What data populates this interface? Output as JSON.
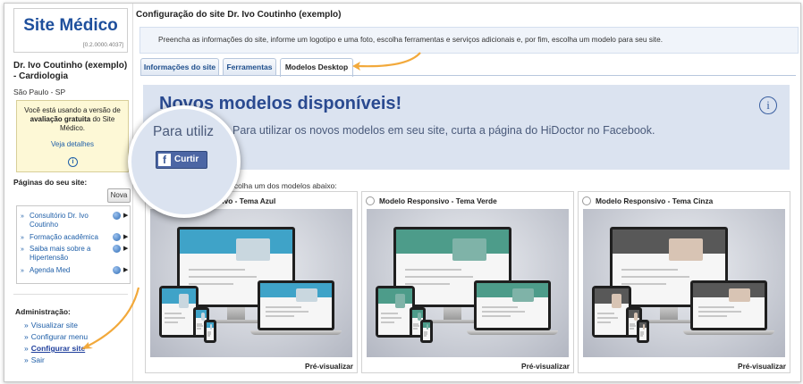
{
  "sidebar": {
    "logo_title": "Site Médico",
    "version": "[0.2.0000.4037]",
    "doctor_name": "Dr. Ivo Coutinho (exemplo) - Cardiologia",
    "city": "São Paulo - SP",
    "evaluation": {
      "text_before": "Você está usando a versão de ",
      "text_bold": "avaliação gratuita",
      "text_after": " do Site Médico.",
      "link": "Veja detalhes",
      "icon": "info-icon"
    },
    "pages_label": "Páginas do seu site:",
    "new_button": "Nova",
    "pages": [
      {
        "label": "Consultório Dr. Ivo Coutinho"
      },
      {
        "label": "Formação acadêmica"
      },
      {
        "label": "Saiba mais sobre a Hipertensão"
      },
      {
        "label": "Agenda Med"
      }
    ],
    "admin_label": "Administração:",
    "admin_items": [
      {
        "label": "Visualizar site"
      },
      {
        "label": "Configurar menu"
      },
      {
        "label": "Configurar site"
      },
      {
        "label": "Sair"
      }
    ]
  },
  "main": {
    "title": "Configuração do site Dr. Ivo Coutinho (exemplo)",
    "intro": "Preencha as informações do site, informe um logotipo e uma foto, escolha ferramentas e serviços adicionais e, por fim, escolha um modelo para seu site.",
    "tabs": [
      {
        "label": "Informações do site"
      },
      {
        "label": "Ferramentas"
      },
      {
        "label": "Modelos Desktop"
      }
    ],
    "active_tab": "Modelos Desktop",
    "banner": {
      "title": "Novos modelos disponíveis!",
      "subtitle": "Para utilizar os novos modelos em seu site, curta a página do HiDoctor no Facebook.",
      "icon": "info-icon"
    },
    "magnifier": {
      "text": "Para utiliz",
      "facebook_button": "Curtir",
      "facebook_icon": "f"
    },
    "choose_text": "Escolha um dos modelos abaixo:",
    "models": [
      {
        "title": "Modelo Responsivo - Tema Azul",
        "preview": "Pré-visualizar",
        "accent": "#3fa3c8",
        "photo": "#c9d7df"
      },
      {
        "title": "Modelo Responsivo - Tema Verde",
        "preview": "Pré-visualizar",
        "accent": "#4d9c8a",
        "photo": "#7fb3a8"
      },
      {
        "title": "Modelo Responsivo - Tema Cinza",
        "preview": "Pré-visualizar",
        "accent": "#585858",
        "photo": "#d8c4b4"
      }
    ]
  },
  "colors": {
    "brand": "#1e4f9c",
    "link": "#1f5fa8",
    "annotation_arrow": "#f2a93b",
    "facebook": "#4c66a4"
  }
}
